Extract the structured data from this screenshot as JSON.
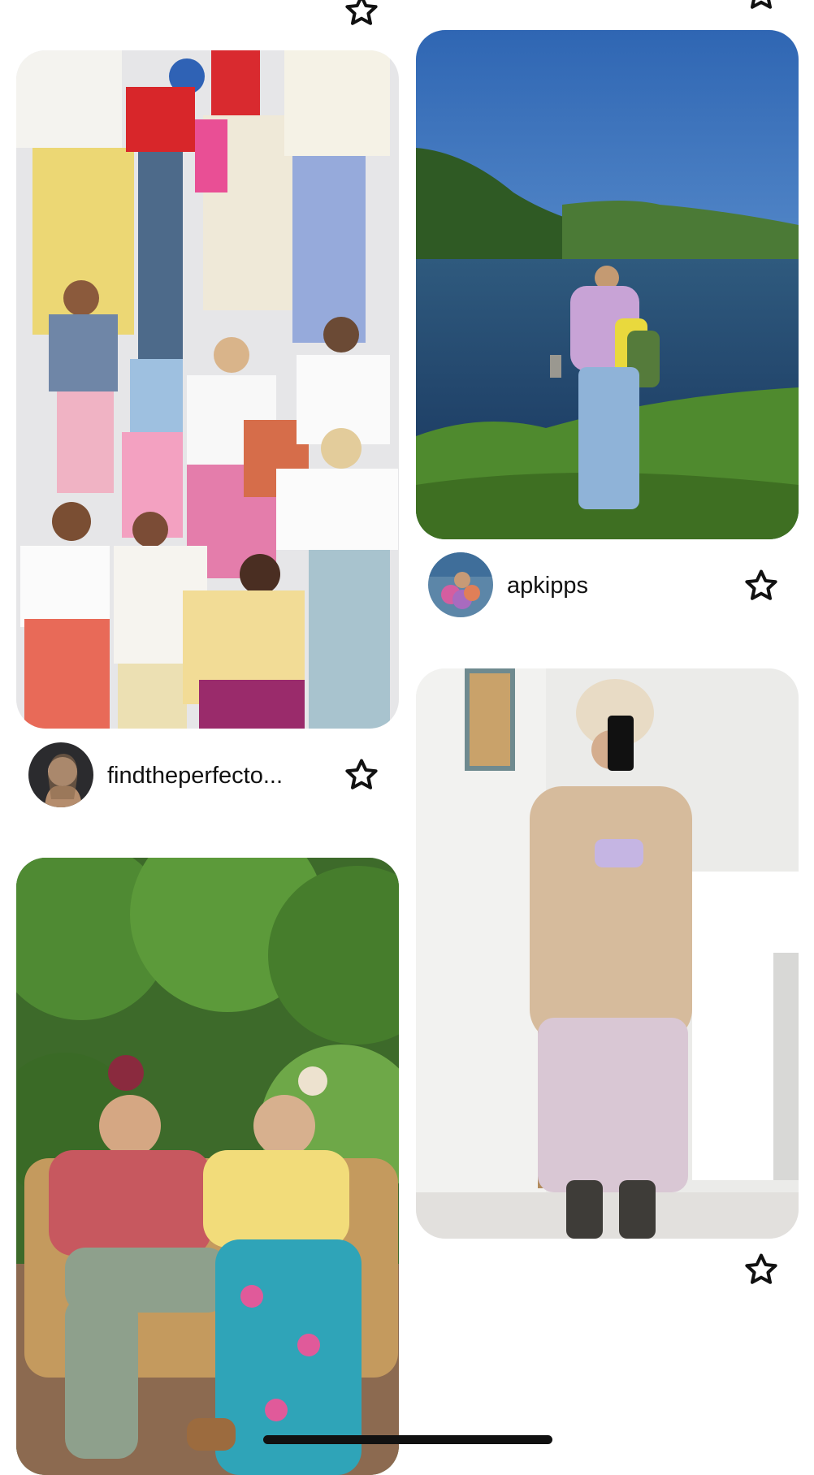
{
  "feed": {
    "pins": [
      {
        "id": "collage",
        "image_description_icon": "outfit-collage-image",
        "username": "findtheperfecto...",
        "has_avatar": true,
        "save_icon": "star-outline-icon"
      },
      {
        "id": "lake",
        "image_description_icon": "lake-outfit-image",
        "username": "apkipps",
        "has_avatar": true,
        "save_icon": "star-outline-icon"
      },
      {
        "id": "garden",
        "image_description_icon": "garden-bench-image",
        "username": "",
        "has_avatar": false,
        "save_icon": "star-outline-icon"
      },
      {
        "id": "mirror",
        "image_description_icon": "mirror-selfie-image",
        "username": "",
        "has_avatar": false,
        "save_icon": "star-outline-icon"
      }
    ]
  },
  "colors": {
    "text": "#111111",
    "background": "#ffffff",
    "icon_stroke": "#111111"
  }
}
